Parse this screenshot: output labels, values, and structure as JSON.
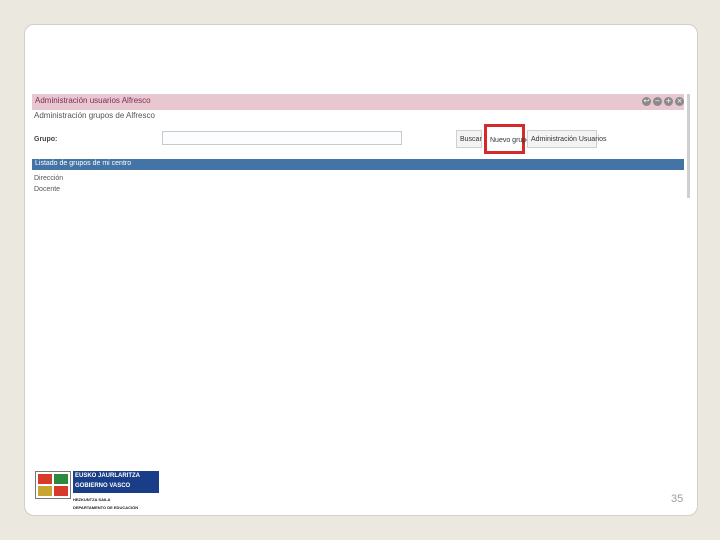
{
  "portlet": {
    "title": "Administración usuarios Alfresco",
    "subtitle": "Administración grupos de Alfresco",
    "controls": [
      {
        "glyph": "↩",
        "icon": "return-icon"
      },
      {
        "glyph": "−",
        "icon": "minimize-icon"
      },
      {
        "glyph": "+",
        "icon": "maximize-icon"
      },
      {
        "glyph": "×",
        "icon": "close-icon"
      }
    ]
  },
  "form": {
    "grupo_label": "Grupo:",
    "grupo_value": "",
    "buscar_label": "Buscar",
    "nuevo_label": "Nuevo grupo",
    "admin_label": "Administración Usuarios"
  },
  "list": {
    "header": "Listado de grupos de mi centro",
    "items": [
      "Dirección",
      "Docente"
    ]
  },
  "footer": {
    "org_line1": "EUSKO JAURLARITZA",
    "org_line2": "GOBIERNO VASCO",
    "dept_line1": "HEZKUNTZA SAILA",
    "dept_line2": "DEPARTAMENTO DE EDUCACIÓN",
    "page_number": "35"
  },
  "colors": {
    "title_bar": "#e9c7d1",
    "list_header": "#4474a6",
    "highlight": "#d42a2a",
    "logo_blue": "#193d86"
  }
}
